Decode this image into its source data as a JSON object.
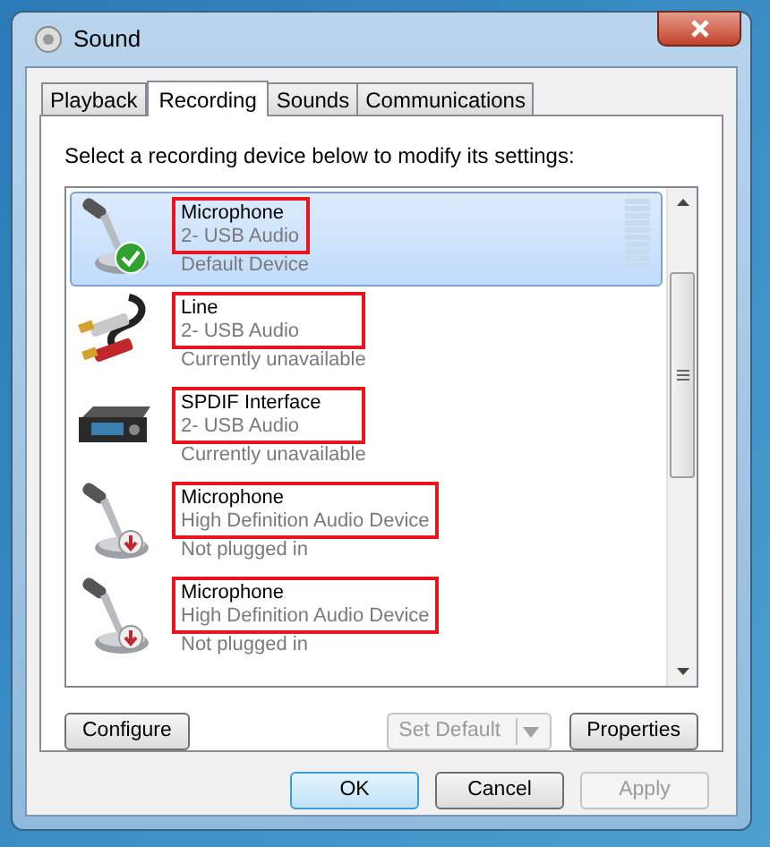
{
  "window": {
    "title": "Sound"
  },
  "tabs": [
    {
      "label": "Playback",
      "selected": false
    },
    {
      "label": "Recording",
      "selected": true
    },
    {
      "label": "Sounds",
      "selected": false
    },
    {
      "label": "Communications",
      "selected": false
    }
  ],
  "instruction": "Select a recording device below to modify its settings:",
  "devices": [
    {
      "kind": "microphone",
      "name": "Microphone",
      "driver": "2- USB Audio",
      "status": "Default Device",
      "is_default": true,
      "unplugged": false,
      "selected": true,
      "highlighted": true,
      "meter": true
    },
    {
      "kind": "line",
      "name": "Line",
      "driver": "2- USB Audio",
      "status": "Currently unavailable",
      "is_default": false,
      "unplugged": false,
      "selected": false,
      "highlighted": true
    },
    {
      "kind": "spdif",
      "name": "SPDIF Interface",
      "driver": "2- USB Audio",
      "status": "Currently unavailable",
      "is_default": false,
      "unplugged": false,
      "selected": false,
      "highlighted": true
    },
    {
      "kind": "microphone",
      "name": "Microphone",
      "driver": "High Definition Audio Device",
      "status": "Not plugged in",
      "is_default": false,
      "unplugged": true,
      "selected": false,
      "highlighted": true
    },
    {
      "kind": "microphone",
      "name": "Microphone",
      "driver": "High Definition Audio Device",
      "status": "Not plugged in",
      "is_default": false,
      "unplugged": true,
      "selected": false,
      "highlighted": true
    }
  ],
  "panel_buttons": [
    {
      "label": "Configure",
      "disabled": false
    },
    {
      "label": "Set Default",
      "disabled": true,
      "kind": "split"
    },
    {
      "label": "Properties",
      "disabled": false
    }
  ],
  "dialog_buttons": [
    {
      "label": "OK",
      "disabled": false,
      "default": true
    },
    {
      "label": "Cancel",
      "disabled": false,
      "default": false
    },
    {
      "label": "Apply",
      "disabled": true,
      "default": false
    }
  ]
}
